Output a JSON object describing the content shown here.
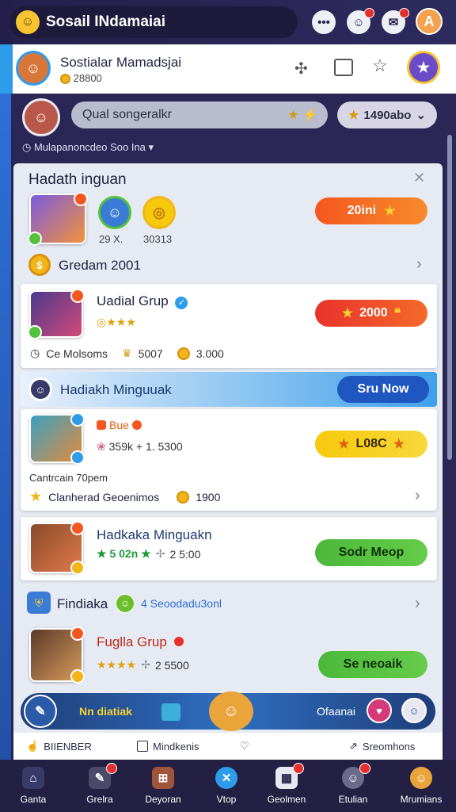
{
  "header": {
    "app_title": "Sosail INdamaiai",
    "logo_icon": "smiley-face-icon"
  },
  "profile": {
    "name": "Sostialar Mamadsjai",
    "coins": "28800"
  },
  "search": {
    "placeholder": "Qual songeralkr",
    "stars": "1490abo"
  },
  "filter": {
    "label": "Mulapanoncdeo Soo Ina"
  },
  "section1": {
    "title": "Hadath inguan",
    "stat1": "29 X.",
    "stat2": "30313",
    "button": "20ini"
  },
  "section2": {
    "title": "Gredam 2001"
  },
  "group1": {
    "title": "Uadial Grup",
    "stat1_label": "Ce Molsoms",
    "stat2_value": "5007",
    "stat3_value": "3.000",
    "button": "2000"
  },
  "banner": {
    "title": "Hadiakh Minguuak",
    "button": "Sru Now"
  },
  "group2": {
    "tag": "Bue",
    "stat": "359k + 1. 5300",
    "button": "L08C",
    "caption": "Cantrcain 70pem",
    "stat2_label": "Clanherad Geoenimos",
    "stat2_value": "1900"
  },
  "group3": {
    "title": "Hadkaka Minguakn",
    "rating": "5 02n",
    "value": "2 5:00",
    "button": "Sodr Meop"
  },
  "section3": {
    "title": "Findiaka",
    "subtitle": "4 Seoodadu3onl"
  },
  "group4": {
    "title": "Fuglla Grup",
    "value": "2 5500",
    "button": "Se neoaik"
  },
  "promo": {
    "left_label": "Nn diatiak",
    "right_label": "Ofaanai"
  },
  "actions": {
    "a1": "BIIENBER",
    "a2": "Mindkenis",
    "a3": "Sreomhons"
  },
  "nav": [
    "Ganta",
    "Grelra",
    "Deyoran",
    "Vtop",
    "Geolmen",
    "Etulian",
    "Mrumians"
  ],
  "colors": {
    "accent_blue": "#2d9de9",
    "orange": "#f4571f",
    "yellow": "#f6c90d",
    "green": "#52c23a",
    "dark": "#242044"
  }
}
